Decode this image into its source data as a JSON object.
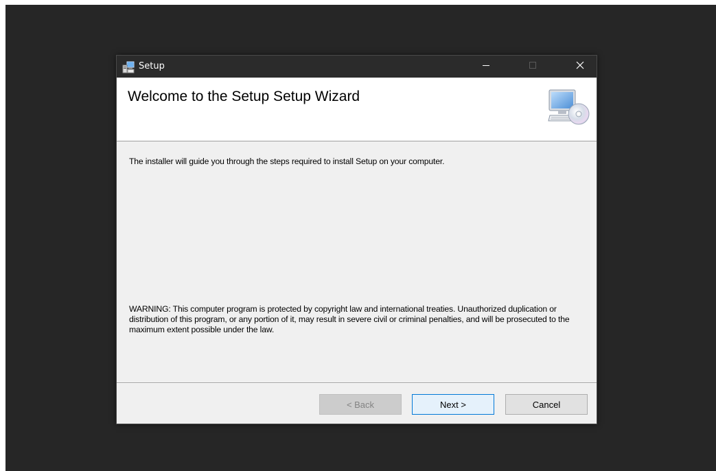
{
  "window": {
    "title": "Setup",
    "controls": {
      "minimize_icon": "minimize-icon",
      "maximize_icon": "maximize-icon",
      "close_icon": "close-icon"
    }
  },
  "header": {
    "title": "Welcome to the Setup Setup Wizard",
    "icon": "computer-cd-icon"
  },
  "body": {
    "intro": "The installer will guide you through the steps required to install Setup on your computer.",
    "warning": "WARNING: This computer program is protected by copyright law and international treaties. Unauthorized duplication or distribution of this program, or any portion of it, may result in severe civil or criminal penalties, and will be prosecuted to the maximum extent possible under the law."
  },
  "buttons": {
    "back": "< Back",
    "next": "Next >",
    "cancel": "Cancel"
  },
  "colors": {
    "desktop": "#262626",
    "titlebar": "#2b2b2b",
    "dialog": "#f0f0f0",
    "accent": "#0078d7"
  }
}
